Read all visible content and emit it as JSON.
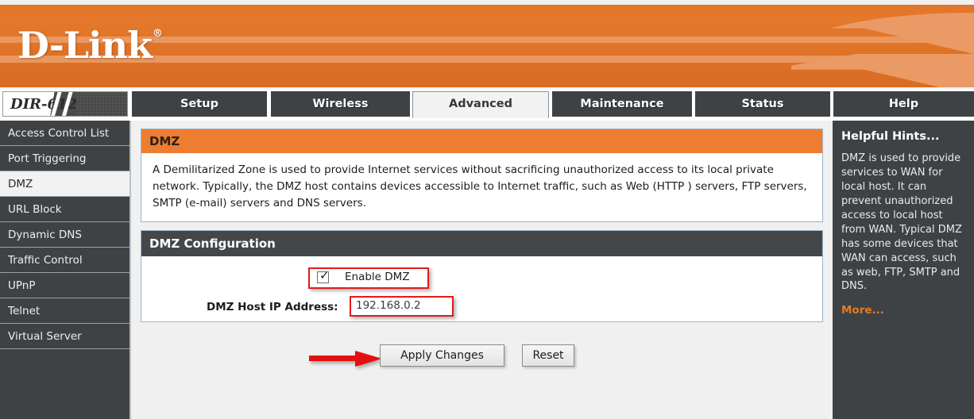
{
  "brand": {
    "logo_text": "D-Link",
    "registered_mark": "®",
    "banner_color": "#e0742a"
  },
  "model_badge": {
    "label": "DIR-612"
  },
  "tabs": [
    {
      "label": "Setup",
      "active": false
    },
    {
      "label": "Wireless",
      "active": false
    },
    {
      "label": "Advanced",
      "active": true
    },
    {
      "label": "Maintenance",
      "active": false
    },
    {
      "label": "Status",
      "active": false
    },
    {
      "label": "Help",
      "active": false
    }
  ],
  "sidebar": {
    "items": [
      {
        "label": "Access Control List",
        "active": false
      },
      {
        "label": "Port Triggering",
        "active": false
      },
      {
        "label": "DMZ",
        "active": true
      },
      {
        "label": "URL Block",
        "active": false
      },
      {
        "label": "Dynamic DNS",
        "active": false
      },
      {
        "label": "Traffic Control",
        "active": false
      },
      {
        "label": "UPnP",
        "active": false
      },
      {
        "label": "Telnet",
        "active": false
      },
      {
        "label": "Virtual Server",
        "active": false
      }
    ]
  },
  "info_panel": {
    "title": "DMZ",
    "description": "A Demilitarized Zone is used to provide Internet services without sacrificing unauthorized access to its local private network. Typically, the DMZ host contains devices accessible to Internet traffic, such as Web (HTTP ) servers, FTP servers, SMTP (e-mail) servers and DNS servers.",
    "header_color": "#ed7d31"
  },
  "config_panel": {
    "title": "DMZ Configuration",
    "enable_label": "Enable DMZ",
    "enable_checked": true,
    "ip_label": "DMZ Host IP Address:",
    "ip_value": "192.168.0.2",
    "highlight_color": "#e01b1b"
  },
  "actions": {
    "apply_label": "Apply Changes",
    "reset_label": "Reset",
    "arrow_color": "#e60f0f"
  },
  "hints": {
    "title": "Helpful Hints...",
    "body": "DMZ is used to provide services to WAN for local host. It can prevent unauthorized access to local host from WAN. Typical DMZ has some devices that WAN can access, such as web, FTP, SMTP and DNS.",
    "more_label": "More...",
    "more_color": "#e07c2c"
  }
}
